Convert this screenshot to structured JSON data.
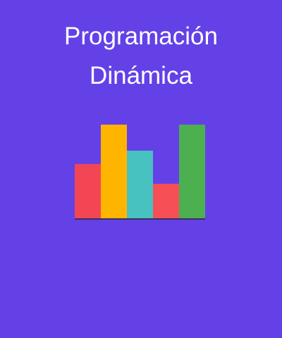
{
  "title": {
    "line1": "Programación",
    "line2": "Dinámica"
  },
  "icon": {
    "name": "bar-chart-icon",
    "bar_levels": [
      0.58,
      1.0,
      0.72,
      0.37,
      1.0
    ],
    "bar_colors": [
      "#f24654",
      "#ffb400",
      "#48c1c1",
      "#f65056",
      "#4caf50"
    ],
    "baseline_color": "#3a2f5c"
  },
  "colors": {
    "background": "#6441e7",
    "text": "#ffffff"
  }
}
